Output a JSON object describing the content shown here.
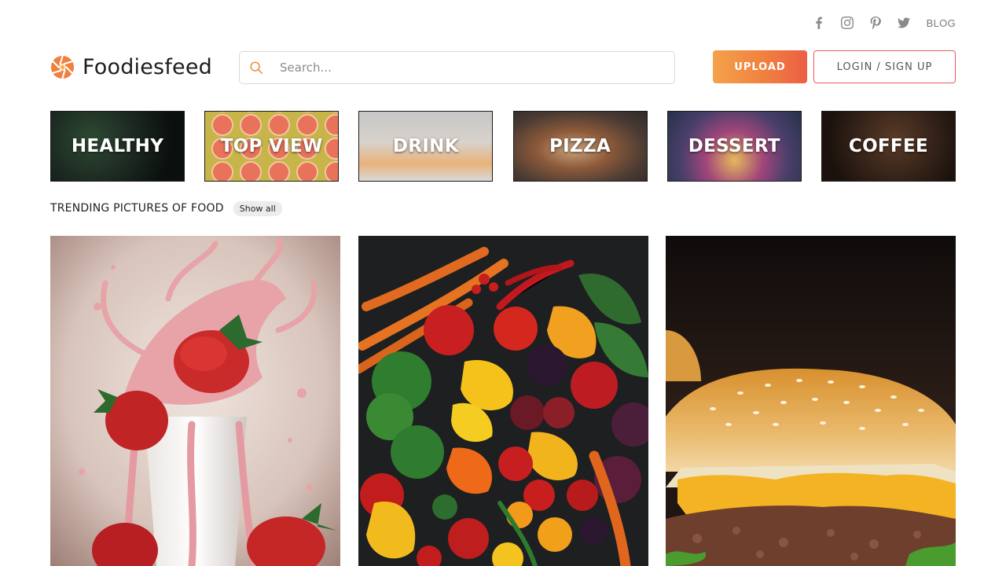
{
  "social": {
    "icons": [
      "facebook-icon",
      "instagram-icon",
      "pinterest-icon",
      "twitter-icon"
    ],
    "blog_label": "BLOG"
  },
  "header": {
    "logo_text": "Foodiesfeed",
    "search_placeholder": "Search...",
    "upload_label": "UPLOAD",
    "login_label": "LOGIN / SIGN UP"
  },
  "categories": [
    {
      "label": "HEALTHY"
    },
    {
      "label": "TOP VIEW"
    },
    {
      "label": "DRINK"
    },
    {
      "label": "PIZZA"
    },
    {
      "label": "DESSERT"
    },
    {
      "label": "COFFEE"
    }
  ],
  "trending": {
    "title": "TRENDING PICTURES OF FOOD",
    "show_all": "Show all"
  },
  "colors": {
    "accent_orange": "#f0803f",
    "accent_red": "#ec5a5a",
    "text_dark": "#1e1e1e",
    "icon_grey": "#8a8a8a"
  },
  "photos": [
    "strawberry-milkshake-photo",
    "vegetables-photo",
    "burger-photo"
  ]
}
